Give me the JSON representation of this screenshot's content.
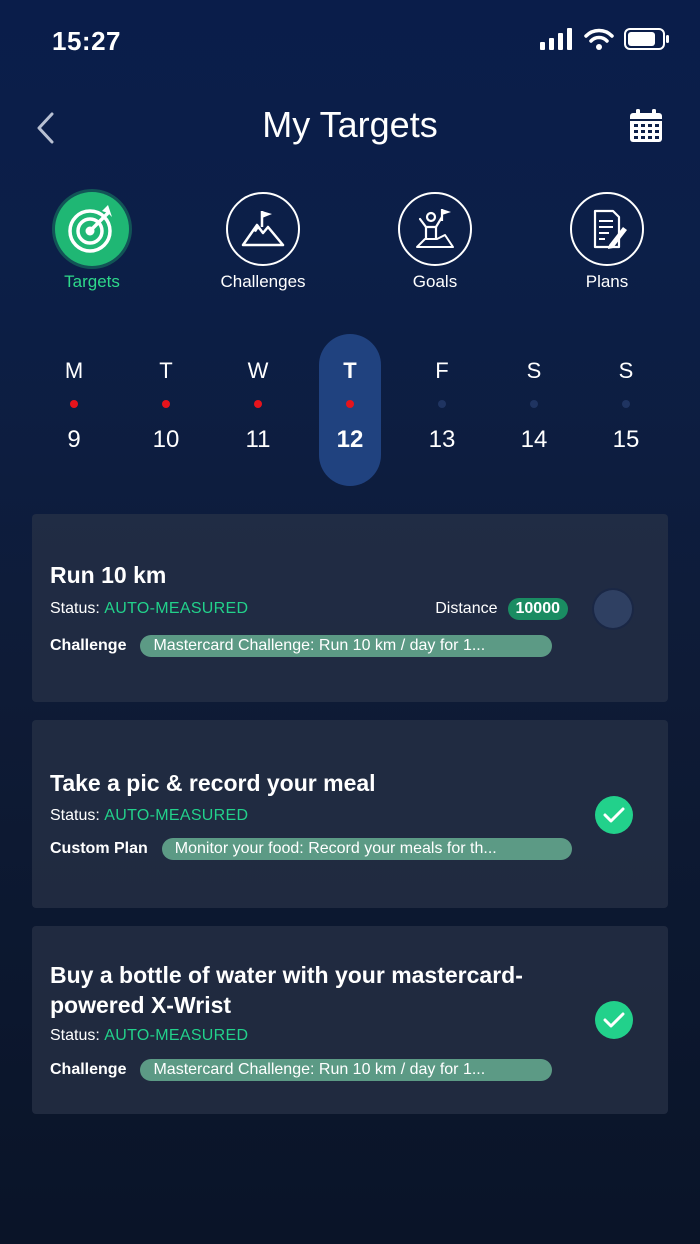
{
  "status_bar": {
    "time": "15:27"
  },
  "header": {
    "title": "My Targets"
  },
  "categories": [
    {
      "label": "Targets",
      "icon": "target-icon",
      "active": true
    },
    {
      "label": "Challenges",
      "icon": "mountain-flag-icon",
      "active": false
    },
    {
      "label": "Goals",
      "icon": "person-flag-icon",
      "active": false
    },
    {
      "label": "Plans",
      "icon": "document-pen-icon",
      "active": false
    }
  ],
  "week": [
    {
      "letter": "M",
      "date": "9",
      "has_target": true,
      "selected": false
    },
    {
      "letter": "T",
      "date": "10",
      "has_target": true,
      "selected": false
    },
    {
      "letter": "W",
      "date": "11",
      "has_target": true,
      "selected": false
    },
    {
      "letter": "T",
      "date": "12",
      "has_target": true,
      "selected": true
    },
    {
      "letter": "F",
      "date": "13",
      "has_target": false,
      "selected": false
    },
    {
      "letter": "S",
      "date": "14",
      "has_target": false,
      "selected": false
    },
    {
      "letter": "S",
      "date": "15",
      "has_target": false,
      "selected": false
    }
  ],
  "targets": [
    {
      "title": "Run 10 km",
      "status_label": "Status:",
      "status_value": "AUTO-MEASURED",
      "distance_label": "Distance",
      "distance_value": "10000",
      "ref_label": "Challenge",
      "ref_value": "Mastercard Challenge: Run 10 km / day for 1...",
      "completed": false
    },
    {
      "title": "Take a pic & record your meal",
      "status_label": "Status:",
      "status_value": "AUTO-MEASURED",
      "ref_label": "Custom Plan",
      "ref_value": "Monitor your food: Record your meals for th...",
      "completed": true
    },
    {
      "title_line1": "Buy a bottle of water with your mastercard-",
      "title_line2": "powered X-Wrist",
      "status_label": "Status:",
      "status_value": "AUTO-MEASURED",
      "ref_label": "Challenge",
      "ref_value": "Mastercard Challenge: Run 10 km / day for 1...",
      "completed": true
    }
  ],
  "colors": {
    "accent_green": "#22d18b",
    "selected_day": "#20427f",
    "dot_red": "#e6131c",
    "pill_green": "#5c9a85"
  }
}
